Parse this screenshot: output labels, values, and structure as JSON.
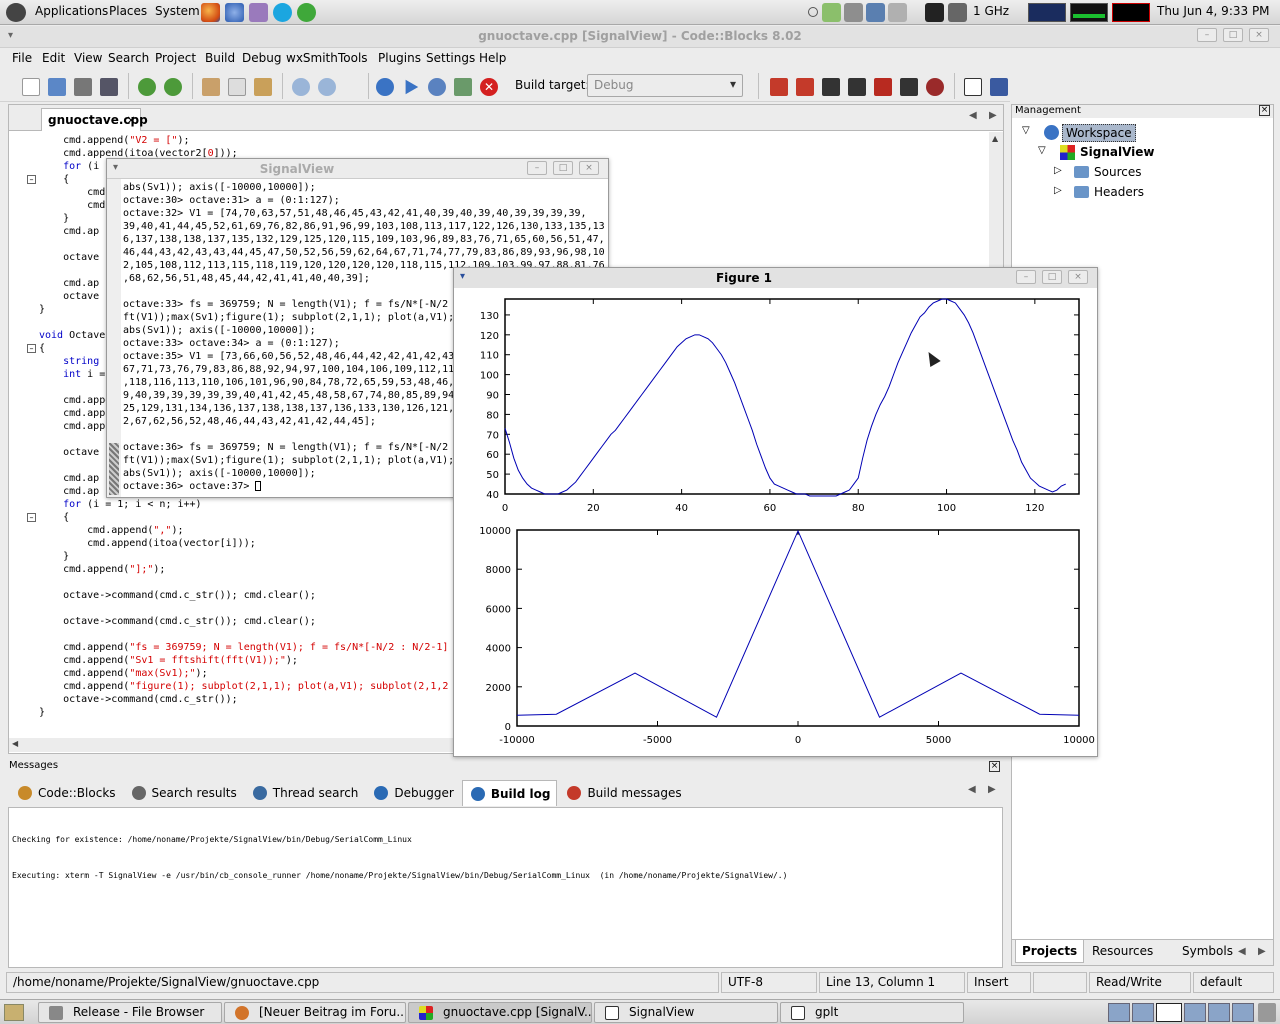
{
  "top_panel": {
    "menus": [
      "Applications",
      "Places",
      "System"
    ],
    "cpu_freq": "1 GHz",
    "datetime": "Thu Jun  4,  9:33 PM"
  },
  "app": {
    "title": "gnuoctave.cpp [SignalView] - Code::Blocks 8.02",
    "menu": [
      "File",
      "Edit",
      "View",
      "Search",
      "Project",
      "Build",
      "Debug",
      "wxSmith",
      "Tools",
      "Plugins",
      "Settings",
      "Help"
    ],
    "build_target_label": "Build target:",
    "build_target_value": "Debug"
  },
  "editor": {
    "tab": "gnuoctave.cpp",
    "lines": [
      {
        "t": "    cmd.append(",
        "s": "\"V2 = [\"",
        "r": ");"
      },
      {
        "t": "    cmd.append(itoa(vector2[",
        "s": "0",
        "r": "]));"
      },
      {
        "t": "    for (i",
        "s": "",
        "r": ""
      },
      {
        "t": "    {",
        "s": "",
        "r": ""
      },
      {
        "t": "        cmd",
        "s": "",
        "r": ""
      },
      {
        "t": "        cmd",
        "s": "",
        "r": ""
      },
      {
        "t": "    }",
        "s": "",
        "r": ""
      },
      {
        "t": "    cmd.ap",
        "s": "",
        "r": ""
      },
      {
        "t": "",
        "s": "",
        "r": ""
      },
      {
        "t": "    octave",
        "s": "",
        "r": ""
      },
      {
        "t": "",
        "s": "",
        "r": ""
      },
      {
        "t": "    cmd.ap",
        "s": "",
        "r": ""
      },
      {
        "t": "    octave",
        "s": "",
        "r": ""
      },
      {
        "t": "}",
        "s": "",
        "r": ""
      },
      {
        "t": "",
        "s": "",
        "r": ""
      },
      {
        "t": "void Octave",
        "s": "",
        "r": ""
      },
      {
        "t": "{",
        "s": "",
        "r": ""
      },
      {
        "t": "    string",
        "s": "",
        "r": ""
      },
      {
        "t": "    int i =",
        "s": "",
        "r": ""
      },
      {
        "t": "",
        "s": "",
        "r": ""
      },
      {
        "t": "    cmd.appe",
        "s": "",
        "r": ""
      },
      {
        "t": "    cmd.app",
        "s": "",
        "r": ""
      },
      {
        "t": "    cmd.app",
        "s": "",
        "r": ""
      },
      {
        "t": "",
        "s": "",
        "r": ""
      },
      {
        "t": "    octave",
        "s": "",
        "r": ""
      },
      {
        "t": "",
        "s": "",
        "r": ""
      },
      {
        "t": "    cmd.ap",
        "s": "",
        "r": ""
      },
      {
        "t": "    cmd.ap",
        "s": "",
        "r": ""
      },
      {
        "t": "    for (i = 1; i < n; i++)",
        "s": "",
        "r": ""
      },
      {
        "t": "    {",
        "s": "",
        "r": ""
      },
      {
        "t": "        cmd.append(",
        "s": "\",\"",
        "r": ");"
      },
      {
        "t": "        cmd.append(itoa(vector[i]));",
        "s": "",
        "r": ""
      },
      {
        "t": "    }",
        "s": "",
        "r": ""
      },
      {
        "t": "    cmd.append(",
        "s": "\"];\"",
        "r": ");"
      },
      {
        "t": "",
        "s": "",
        "r": ""
      },
      {
        "t": "    octave->command(cmd.c_str()); cmd.clear();",
        "s": "",
        "r": ""
      },
      {
        "t": "",
        "s": "",
        "r": ""
      },
      {
        "t": "    octave->command(cmd.c_str()); cmd.clear();",
        "s": "",
        "r": ""
      },
      {
        "t": "",
        "s": "",
        "r": ""
      },
      {
        "t": "    cmd.append(",
        "s": "\"fs = 369759; N = length(V1); f = fs/N*[-N/2 : N/2-1]",
        "r": ""
      },
      {
        "t": "    cmd.append(",
        "s": "\"Sv1 = fftshift(fft(V1));\"",
        "r": ");"
      },
      {
        "t": "    cmd.append(",
        "s": "\"max(Sv1);\"",
        "r": ");"
      },
      {
        "t": "    cmd.append(",
        "s": "\"figure(1); subplot(2,1,1); plot(a,V1); subplot(2,1,2",
        "r": ""
      },
      {
        "t": "    octave->command(cmd.c_str());",
        "s": "",
        "r": ""
      },
      {
        "t": "}",
        "s": "",
        "r": ""
      }
    ]
  },
  "management": {
    "title": "Management",
    "tree": {
      "workspace": "Workspace",
      "project": "SignalView",
      "folders": [
        "Sources",
        "Headers"
      ]
    },
    "tabs": [
      "Projects",
      "Resources",
      "Symbols"
    ]
  },
  "terminal": {
    "title": "SignalView",
    "lines": [
      "abs(Sv1)); axis([-10000,10000]);",
      "octave:30> octave:31> a = (0:1:127);",
      "octave:32> V1 = [74,70,63,57,51,48,46,45,43,42,41,40,39,40,39,40,39,39,39,39,",
      "39,40,41,44,45,52,61,69,76,82,86,91,96,99,103,108,113,117,122,126,130,133,135,13",
      "6,137,138,138,137,135,132,129,125,120,115,109,103,96,89,83,76,71,65,60,56,51,47,",
      "46,44,43,42,43,43,44,45,47,50,52,56,59,62,64,67,71,74,77,79,83,86,89,93,96,98,10",
      "2,105,108,112,113,115,118,119,120,120,120,120,118,115,112,109,103,99,97,88,81,76",
      ",68,62,56,51,48,45,44,42,41,41,40,40,39];",
      "",
      "octave:33> fs = 369759; N = length(V1); f = fs/N*[-N/2",
      "ft(V1));max(Sv1);figure(1); subplot(2,1,1); plot(a,V1);",
      "abs(Sv1)); axis([-10000,10000]);",
      "octave:33> octave:34> a = (0:1:127);",
      "octave:35> V1 = [73,66,60,56,52,48,46,44,42,42,41,42,43",
      "67,71,73,76,79,83,86,88,92,94,97,100,104,106,109,112,11",
      ",118,116,113,110,106,101,96,90,84,78,72,65,59,53,48,46,",
      "9,40,39,39,39,39,39,40,41,42,45,48,58,67,74,80,85,89,94",
      "25,129,131,134,136,137,138,138,137,136,133,130,126,121,",
      "2,67,62,56,52,48,46,44,43,42,41,42,44,45];",
      "",
      "octave:36> fs = 369759; N = length(V1); f = fs/N*[-N/2",
      "ft(V1));max(Sv1);figure(1); subplot(2,1,1); plot(a,V1);",
      "abs(Sv1)); axis([-10000,10000]);",
      "octave:36> octave:37> "
    ]
  },
  "figure": {
    "title": "Figure 1"
  },
  "chart_data": [
    {
      "type": "line",
      "xlim": [
        0,
        130
      ],
      "ylim": [
        40,
        138
      ],
      "x_ticks": [
        0,
        20,
        40,
        60,
        80,
        100,
        120
      ],
      "y_ticks": [
        40,
        50,
        60,
        70,
        80,
        90,
        100,
        110,
        120,
        130
      ],
      "series": [
        {
          "values": [
            73,
            66,
            58,
            52,
            48,
            45,
            43,
            42,
            41,
            40,
            40,
            40,
            40,
            41,
            42,
            44,
            46,
            49,
            52,
            55,
            58,
            61,
            64,
            67,
            70,
            72,
            75,
            78,
            81,
            84,
            87,
            90,
            93,
            96,
            99,
            102,
            105,
            108,
            111,
            114,
            116,
            118,
            119,
            120,
            120,
            119,
            118,
            116,
            113,
            110,
            106,
            101,
            96,
            90,
            84,
            78,
            72,
            65,
            59,
            53,
            48,
            45,
            44,
            43,
            42,
            41,
            40,
            40,
            40,
            39,
            39,
            39,
            39,
            39,
            39,
            39,
            40,
            41,
            42,
            45,
            48,
            58,
            67,
            74,
            80,
            85,
            89,
            94,
            100,
            106,
            111,
            116,
            121,
            125,
            129,
            131,
            134,
            136,
            137,
            138,
            138,
            137,
            136,
            133,
            130,
            126,
            121,
            115,
            109,
            103,
            97,
            91,
            85,
            79,
            73,
            67,
            62,
            56,
            52,
            48,
            46,
            44,
            43,
            42,
            41,
            42,
            44,
            45
          ]
        }
      ]
    },
    {
      "type": "line",
      "xlim": [
        -10000,
        10000
      ],
      "ylim": [
        0,
        10000
      ],
      "x_ticks": [
        -10000,
        -5000,
        0,
        5000,
        10000
      ],
      "y_ticks": [
        0,
        2000,
        4000,
        6000,
        8000,
        10000
      ],
      "series": [
        {
          "x": [
            -10000,
            -8600,
            -5800,
            -2900,
            0,
            2900,
            5800,
            8600,
            10000
          ],
          "y": [
            550,
            600,
            2700,
            450,
            9950,
            450,
            2700,
            600,
            550
          ]
        }
      ]
    }
  ],
  "messages": {
    "title": "Messages",
    "tabs": [
      "Code::Blocks",
      "Search results",
      "Thread search",
      "Debugger",
      "Build log",
      "Build messages"
    ],
    "active_tab": "Build log",
    "log": [
      "Checking for existence: /home/noname/Projekte/SignalView/bin/Debug/SerialComm_Linux",
      "Executing: xterm -T SignalView -e /usr/bin/cb_console_runner /home/noname/Projekte/SignalView/bin/Debug/SerialComm_Linux  (in /home/noname/Projekte/SignalView/.)"
    ]
  },
  "statusbar": {
    "path": "/home/noname/Projekte/SignalView/gnuoctave.cpp",
    "encoding": "UTF-8",
    "position": "Line 13, Column 1",
    "mode": "Insert",
    "access": "Read/Write",
    "profile": "default"
  },
  "taskbar": {
    "items": [
      "Release - File Browser",
      "[Neuer Beitrag im Foru...",
      "gnuoctave.cpp [SignalV...",
      "SignalView",
      "gplt"
    ]
  },
  "colors": {
    "plot_line": "#0000b4",
    "string": "#d40000",
    "keyword": "#0000c8",
    "selection": "#7f9ecc"
  }
}
